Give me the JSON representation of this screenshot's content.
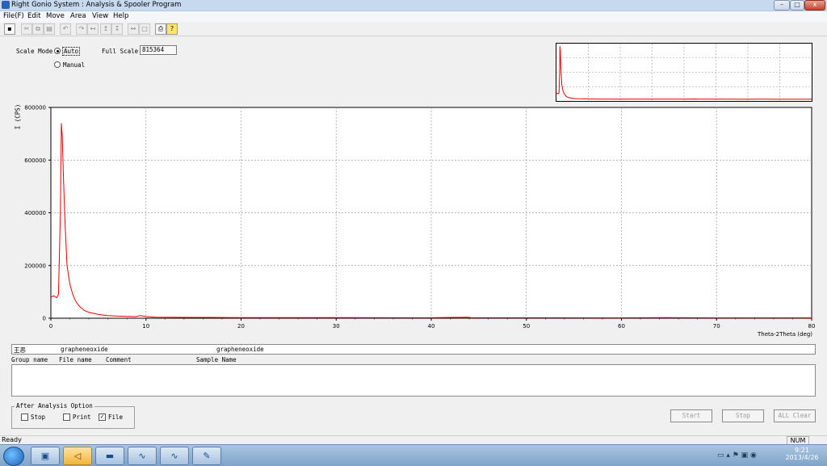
{
  "window": {
    "title": "Right Gonio System : Analysis & Spooler Program",
    "min": "–",
    "max": "□",
    "close": "x"
  },
  "menu": [
    "File(F)",
    "Edit",
    "Move",
    "Area",
    "View",
    "Help"
  ],
  "toolbar": {
    "icons": [
      "save-icon",
      "cut-icon",
      "copy-icon",
      "paste-icon",
      "undo-icon",
      "redo-icon",
      "move-left-icon",
      "peak-up-icon",
      "peak-down-icon",
      "fit-icon",
      "zoom-icon",
      "print-icon",
      "help-icon"
    ]
  },
  "scale": {
    "mode_label": "Scale Mode",
    "auto_label": "Auto",
    "manual_label": "Manual",
    "full_label": "Full Scale",
    "full_value": "815364",
    "mode": "Auto"
  },
  "chart_data": {
    "type": "line",
    "ylabel": "I (CPS)",
    "xlabel": "Theta-2Theta (deg)",
    "xlim": [
      0,
      80
    ],
    "ylim": [
      0,
      800000
    ],
    "yticks": [
      "800000",
      "600000",
      "400000",
      "200000",
      "0"
    ],
    "xticks": [
      "0",
      "10",
      "20",
      "30",
      "40",
      "50",
      "60",
      "70",
      "80"
    ],
    "grid": true,
    "series": [
      {
        "color": "#e00000",
        "x": [
          0,
          0.3,
          0.6,
          0.8,
          1.0,
          1.1,
          1.2,
          1.3,
          1.5,
          1.7,
          2.0,
          2.3,
          2.6,
          3.0,
          3.5,
          4.0,
          5.0,
          6.0,
          7.0,
          8.0,
          9.0,
          9.4,
          10.0,
          11.0,
          15.0,
          20.0,
          30.0,
          40.0,
          43.8,
          44.2,
          50.0,
          60.0,
          64.4,
          70.0,
          77.5,
          80.0
        ],
        "y": [
          80000,
          85000,
          78000,
          90000,
          400000,
          740000,
          690000,
          560000,
          350000,
          200000,
          130000,
          90000,
          65000,
          45000,
          30000,
          22000,
          14000,
          10000,
          8000,
          7000,
          6000,
          10000,
          6000,
          4000,
          3000,
          2500,
          2000,
          1800,
          4000,
          1800,
          1700,
          1600,
          2500,
          1500,
          1500,
          1500
        ]
      }
    ]
  },
  "overview": {
    "color": "#e00000"
  },
  "list": {
    "row1": [
      "王恶",
      "grapheneoxide",
      "grapheneoxide"
    ],
    "headers": [
      "Group name",
      "File name",
      "Comment",
      "Sample Name"
    ]
  },
  "options": {
    "legend": "After Analysis Option",
    "stop": "Stop",
    "print": "Print",
    "file": "File",
    "file_checked": "✓"
  },
  "buttons": {
    "start": "Start",
    "stop": "Stop",
    "clear": "ALL Clear"
  },
  "status": {
    "text": "Ready",
    "num": "NUM"
  },
  "taskbar": {
    "time": "9:21",
    "date": "2013/4/26"
  }
}
